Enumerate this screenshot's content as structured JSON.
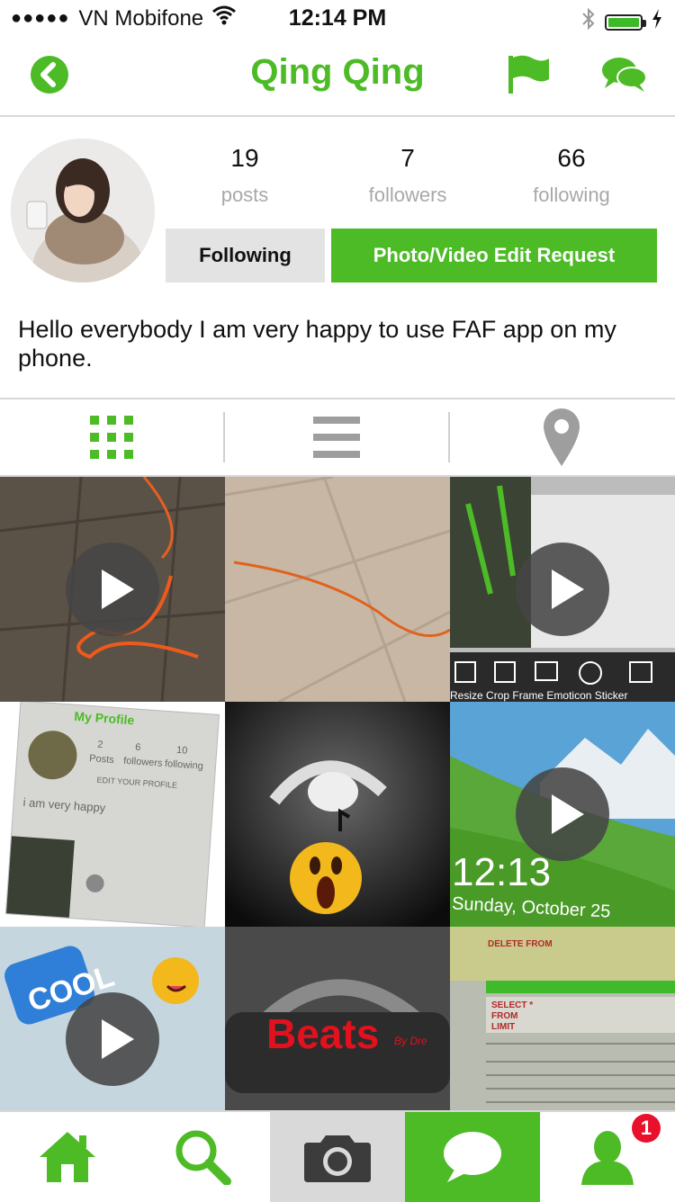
{
  "status_bar": {
    "signal": "●●●●●",
    "carrier": "VN Mobifone",
    "time": "12:14 PM",
    "icons": [
      "wifi-icon",
      "bluetooth-icon",
      "battery-icon",
      "charging-icon"
    ],
    "battery_level": 1.0
  },
  "header": {
    "title": "Qing Qing",
    "icons": [
      "back-icon",
      "flag-icon",
      "chat-icon"
    ]
  },
  "profile": {
    "stats": [
      {
        "num": "19",
        "label": "posts"
      },
      {
        "num": "7",
        "label": "followers"
      },
      {
        "num": "66",
        "label": "following"
      }
    ],
    "following_button": "Following",
    "edit_request_button": "Photo/Video Edit Request",
    "bio": "Hello everybody I am very happy to use FAF app on my phone."
  },
  "view_tabs": [
    {
      "icon": "grid-icon",
      "active": true
    },
    {
      "icon": "list-icon",
      "active": false
    },
    {
      "icon": "location-pin-icon",
      "active": false
    }
  ],
  "grid": {
    "cells": [
      {
        "kind": "video",
        "subject": "floor with orange cable"
      },
      {
        "kind": "photo",
        "subject": "tiled floor with orange wire"
      },
      {
        "kind": "video",
        "subject": "editor screen",
        "labels": [
          "Resize",
          "Crop",
          "Frame",
          "Emoticon",
          "Sticker"
        ]
      },
      {
        "kind": "photo",
        "subject": "app profile screenshot",
        "labels": [
          "My Profile",
          "2",
          "Posts",
          "6",
          "followers",
          "10",
          "following",
          "EDIT YOUR PROFILE",
          "i am very happy"
        ]
      },
      {
        "kind": "photo",
        "subject": "headphones with emoji"
      },
      {
        "kind": "video",
        "subject": "lock screen",
        "labels": [
          "12:13",
          "Sunday, October 25"
        ]
      },
      {
        "kind": "video",
        "subject": "cool sticker",
        "labels": [
          "COOL"
        ]
      },
      {
        "kind": "photo",
        "subject": "beats headphones",
        "labels": [
          "Beats",
          "By Dre"
        ]
      },
      {
        "kind": "photo",
        "subject": "database screen",
        "labels": [
          "DELETE FROM",
          "SELECT *",
          "FROM",
          "LIMIT"
        ]
      }
    ]
  },
  "bottom_nav": {
    "items": [
      {
        "icon": "home-icon",
        "active": false
      },
      {
        "icon": "search-icon",
        "active": false
      },
      {
        "icon": "camera-icon",
        "active": false
      },
      {
        "icon": "message-icon",
        "active": true
      },
      {
        "icon": "profile-icon",
        "active": false
      }
    ],
    "profile_badge": "1"
  },
  "colors": {
    "brand_green": "#4cbb26",
    "badge_red": "#e8102a"
  }
}
